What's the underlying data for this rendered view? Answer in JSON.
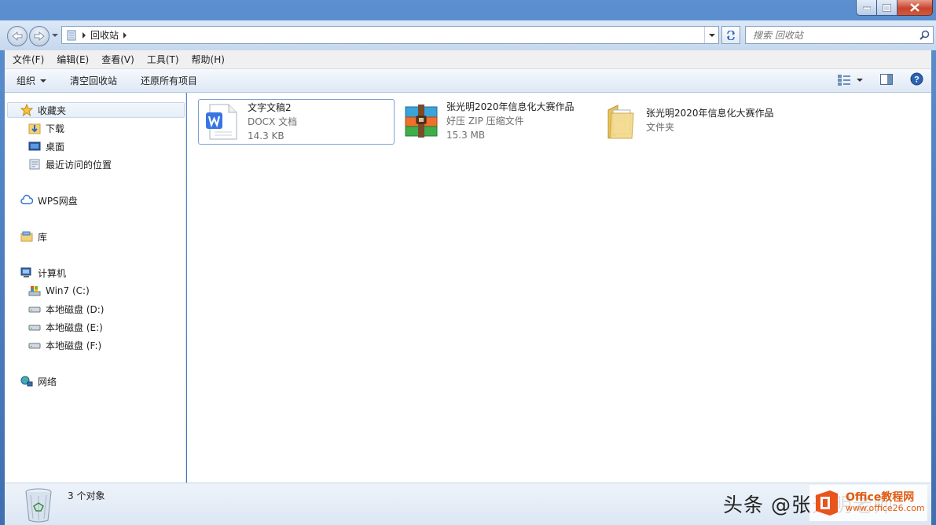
{
  "window": {
    "path": [
      "回收站"
    ]
  },
  "search": {
    "placeholder": "搜索 回收站"
  },
  "menubar": {
    "items": [
      {
        "label": "文件(F)"
      },
      {
        "label": "编辑(E)"
      },
      {
        "label": "查看(V)"
      },
      {
        "label": "工具(T)"
      },
      {
        "label": "帮助(H)"
      }
    ]
  },
  "commandbar": {
    "organize": "组织",
    "empty_bin": "清空回收站",
    "restore_all": "还原所有项目"
  },
  "navpane": {
    "favorites": "收藏夹",
    "downloads": "下载",
    "desktop": "桌面",
    "recent": "最近访问的位置",
    "wps": "WPS网盘",
    "libraries": "库",
    "computer": "计算机",
    "drive_c": "Win7 (C:)",
    "drive_d": "本地磁盘 (D:)",
    "drive_e": "本地磁盘 (E:)",
    "drive_f": "本地磁盘 (F:)",
    "network": "网络"
  },
  "files": [
    {
      "name": "文字文稿2",
      "type": "DOCX 文档",
      "size": "14.3 KB",
      "icon": "wps-doc-icon"
    },
    {
      "name": "张光明2020年信息化大赛作品",
      "type": "好压 ZIP 压缩文件",
      "size": "15.3 MB",
      "icon": "zip-archive-icon"
    },
    {
      "name": "张光明2020年信息化大赛作品",
      "type": "文件夹",
      "icon": "folder-icon"
    }
  ],
  "status": {
    "count": "3 个对象"
  },
  "watermark": {
    "text": "头条 @张光明老师",
    "site_cn": "Office教程网",
    "site_url": "www.office26.com"
  },
  "colors": {
    "frame": "#4a7fc1",
    "selection_border": "#7da2ce",
    "office_orange": "#e05c10"
  }
}
